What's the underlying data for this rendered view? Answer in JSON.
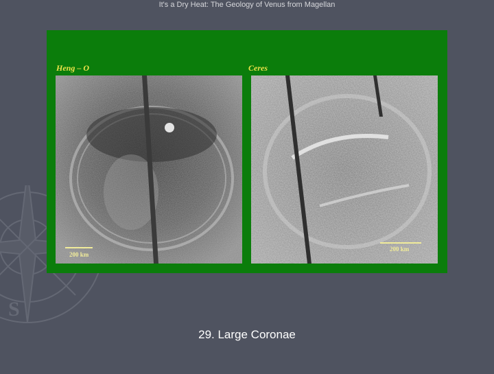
{
  "header": {
    "title": "It's a Dry Heat: The Geology of Venus from Magellan"
  },
  "figure": {
    "panels": [
      {
        "label": "Heng – O",
        "scale_label": "200 km"
      },
      {
        "label": "Ceres",
        "scale_label": "200 km"
      }
    ]
  },
  "caption": "29. Large Coronae",
  "colors": {
    "background": "#4f5360",
    "plate": "#0b7d0b",
    "label": "#ece24a"
  },
  "icons": {
    "background_watermark": "compass-rose-icon"
  }
}
